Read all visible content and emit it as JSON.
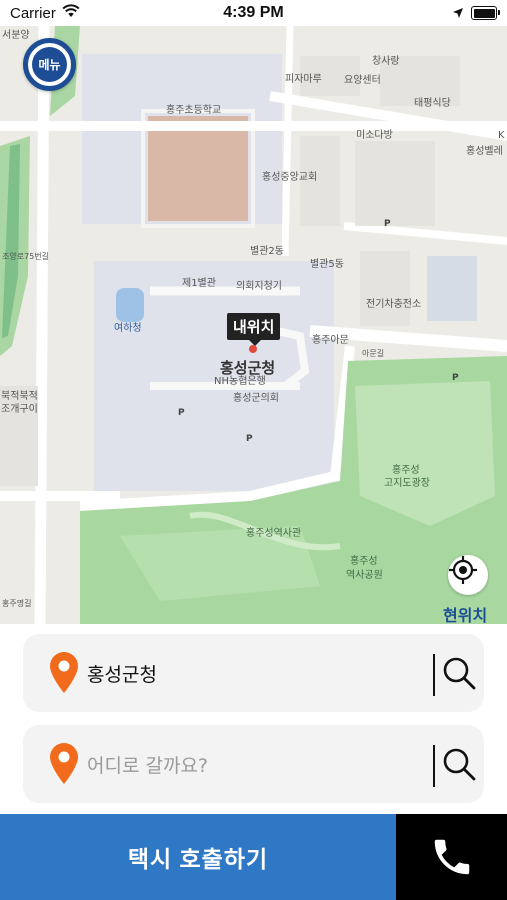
{
  "status": {
    "carrier": "Carrier",
    "time": "4:39 PM"
  },
  "menu": {
    "label": "메뉴"
  },
  "map": {
    "my_location_tag": "내위치",
    "center_label": "홍성군청",
    "locate_label": "현위치",
    "labels": [
      {
        "id": "seobunyang",
        "text": "서분양"
      },
      {
        "id": "pizza",
        "text": "피자마루"
      },
      {
        "id": "changsarang",
        "text": "창사랑"
      },
      {
        "id": "nursing",
        "text": "요양센터"
      },
      {
        "id": "taepyeong",
        "text": "태평식당"
      },
      {
        "id": "hongju-school",
        "text": "홍주초등학교"
      },
      {
        "id": "misodabang",
        "text": "미소다방"
      },
      {
        "id": "k",
        "text": "K"
      },
      {
        "id": "hongseongbel",
        "text": "홍성벨레"
      },
      {
        "id": "church",
        "text": "홍성중앙교회"
      },
      {
        "id": "annex2",
        "text": "별관2동"
      },
      {
        "id": "annex5",
        "text": "별관5동"
      },
      {
        "id": "annex1",
        "text": "제1별관"
      },
      {
        "id": "council-office",
        "text": "의회지청기"
      },
      {
        "id": "ev-station",
        "text": "전기차충전소"
      },
      {
        "id": "yeohacheong",
        "text": "여하청"
      },
      {
        "id": "hongjuamun",
        "text": "홍주아문"
      },
      {
        "id": "nh-bank",
        "text": "NH농협은행"
      },
      {
        "id": "gun-council",
        "text": "홍성군의회"
      },
      {
        "id": "bukjeok",
        "text": "북적북적"
      },
      {
        "id": "jogaeguyi",
        "text": "조개구이"
      },
      {
        "id": "road-label",
        "text": "조양로75번길"
      },
      {
        "id": "road-east",
        "text": "아문길"
      },
      {
        "id": "gojido",
        "text": "홍주성"
      },
      {
        "id": "gojido2",
        "text": "고지도광장"
      },
      {
        "id": "history-hall",
        "text": "홍주성역사관"
      },
      {
        "id": "history-park",
        "text": "홍주성"
      },
      {
        "id": "history-park2",
        "text": "역사공원"
      },
      {
        "id": "jomyeong",
        "text": "홍주명길"
      },
      {
        "id": "parking",
        "text": "P"
      }
    ]
  },
  "origin": {
    "value": "홍성군청"
  },
  "destination": {
    "placeholder": "어디로 갈까요?"
  },
  "actions": {
    "call_taxi": "택시 호출하기"
  },
  "colors": {
    "brand_blue": "#1d4e95",
    "button_blue": "#2f78c5",
    "pin_orange": "#f26a1b",
    "park_green": "#a8d8a0",
    "water_green": "#7fc08a"
  }
}
